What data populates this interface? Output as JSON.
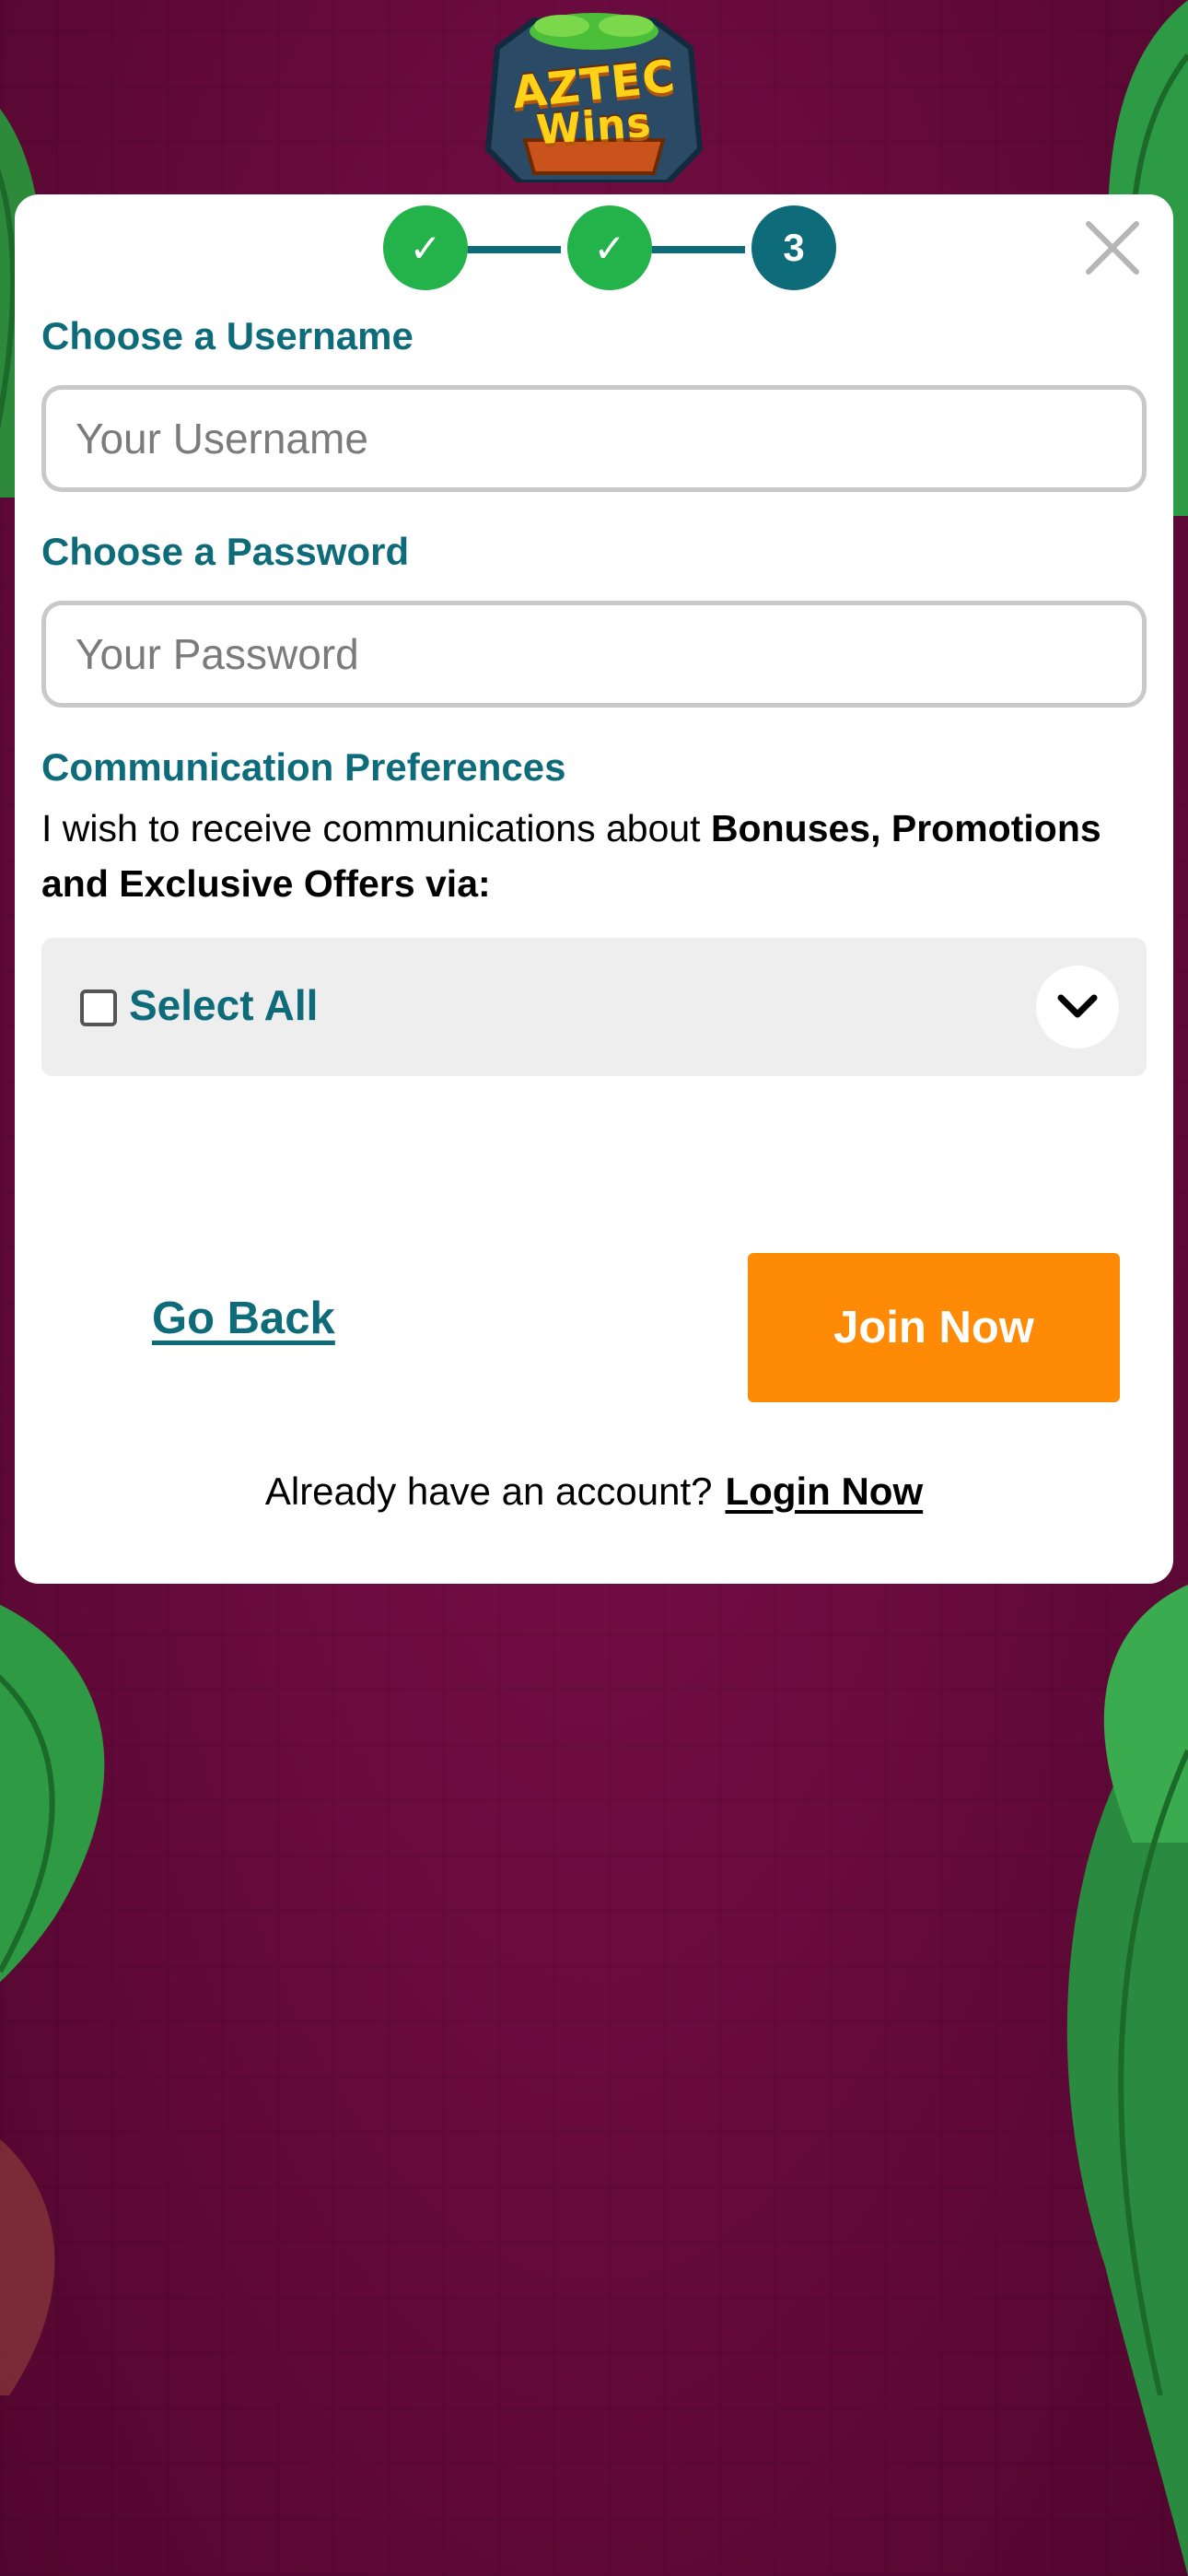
{
  "brand": {
    "name_line1": "AZTEC",
    "name_line2": "Wins"
  },
  "progress": {
    "steps": [
      {
        "state": "done",
        "mark": "✓"
      },
      {
        "state": "done",
        "mark": "✓"
      },
      {
        "state": "current",
        "mark": "3"
      }
    ]
  },
  "form": {
    "username_label": "Choose a Username",
    "username_placeholder": "Your Username",
    "password_label": "Choose a Password",
    "password_placeholder": "Your Password",
    "comm_title": "Communication Preferences",
    "comm_text_plain": "I wish to receive communications about ",
    "comm_text_bold": "Bonuses, Promotions and Exclusive Offers via:",
    "select_all_label": "Select All",
    "select_all_checked": false
  },
  "actions": {
    "go_back": "Go Back",
    "join_now": "Join Now",
    "already_text": "Already have an account?",
    "login_now": "Login Now"
  },
  "colors": {
    "accent": "#0d6b7a",
    "step_done": "#23b34a",
    "cta": "#ff8a05",
    "background": "#6a0b3e"
  },
  "icons": {
    "close": "close-icon",
    "chevron": "chevron-down-icon",
    "check": "checkmark-icon"
  }
}
